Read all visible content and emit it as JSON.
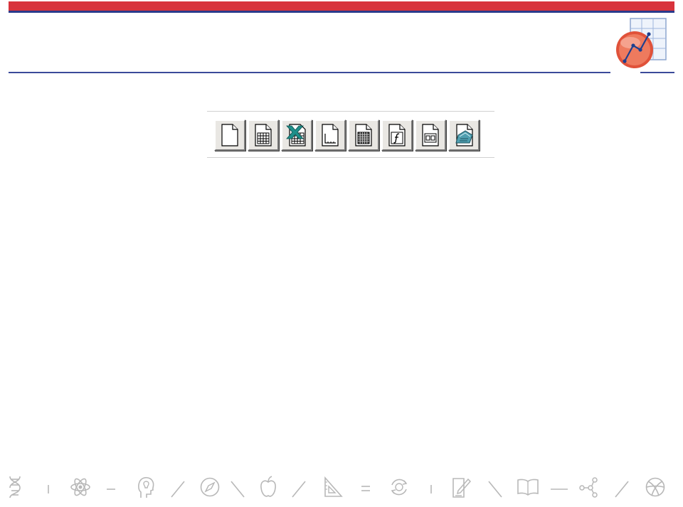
{
  "colors": {
    "header_red": "#d8333c",
    "header_blue": "#2a3a8c",
    "rule_blue": "#3b4a9a",
    "logo_orange": "#e05a3a",
    "icon_gray": "#b8b8b8"
  },
  "toolbar": {
    "buttons": [
      {
        "icon": "new-blank-document-icon"
      },
      {
        "icon": "new-worksheet-icon"
      },
      {
        "icon": "new-excel-workbook-icon"
      },
      {
        "icon": "new-graph-icon"
      },
      {
        "icon": "new-matrix-icon"
      },
      {
        "icon": "new-function-icon"
      },
      {
        "icon": "new-layout-page-icon"
      },
      {
        "icon": "new-notes-icon"
      }
    ]
  },
  "footer": {
    "icons": [
      "dna-icon",
      "atom-icon",
      "head-idea-icon",
      "compass-icon",
      "apple-icon",
      "ruler-triangle-icon",
      "recycle-brain-icon",
      "pencil-paper-icon",
      "open-book-icon",
      "network-nodes-icon",
      "basketball-icon"
    ]
  }
}
